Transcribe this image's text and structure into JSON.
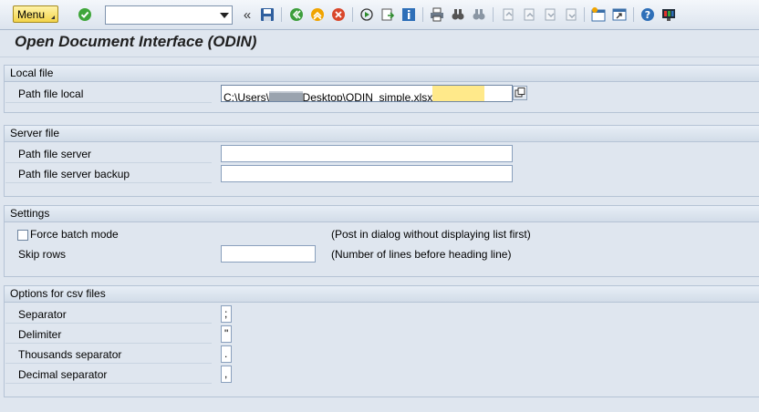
{
  "toolbar": {
    "menu_label": "Menu",
    "command_field_value": "",
    "icons": [
      "enter-icon",
      "back-double-arrow-icon",
      "save-icon",
      "back-icon",
      "exit-icon",
      "cancel-icon",
      "execute-icon",
      "get-variant-icon",
      "info-icon",
      "print-icon",
      "find-icon",
      "find-next-icon",
      "first-page-icon",
      "previous-page-icon",
      "next-page-icon",
      "last-page-icon",
      "create-session-icon",
      "shortcut-icon",
      "help-icon",
      "customize-layout-icon"
    ]
  },
  "page": {
    "title": "Open Document Interface (ODIN)"
  },
  "groups": {
    "local_file": {
      "heading": "Local file",
      "path_label": "Path file local",
      "path_value": "C:\\Users\\",
      "path_value_redacted": "██████",
      "path_value_suffix": "Desktop\\ODIN_simple.xlsx"
    },
    "server_file": {
      "heading": "Server file",
      "path_label": "Path file server",
      "path_value": "",
      "backup_label": "Path file server backup",
      "backup_value": ""
    },
    "settings": {
      "heading": "Settings",
      "force_batch_label": "Force batch mode",
      "force_batch_checked": false,
      "force_batch_hint": "(Post in dialog without displaying list first)",
      "skip_rows_label": "Skip rows",
      "skip_rows_value": "",
      "skip_rows_hint": "(Number of lines before heading line)"
    },
    "csv": {
      "heading": "Options for csv files",
      "separator_label": "Separator",
      "separator_value": ";",
      "delimiter_label": "Delimiter",
      "delimiter_value": "\"",
      "thousands_label": "Thousands separator",
      "thousands_value": ".",
      "decimal_label": "Decimal separator",
      "decimal_value": ","
    }
  },
  "colors": {
    "background": "#dfe6ef",
    "highlight_field": "#ffe98a",
    "enter_green": "#3fa63a",
    "cancel_red": "#d9472b",
    "help_blue": "#2e6fb8"
  }
}
